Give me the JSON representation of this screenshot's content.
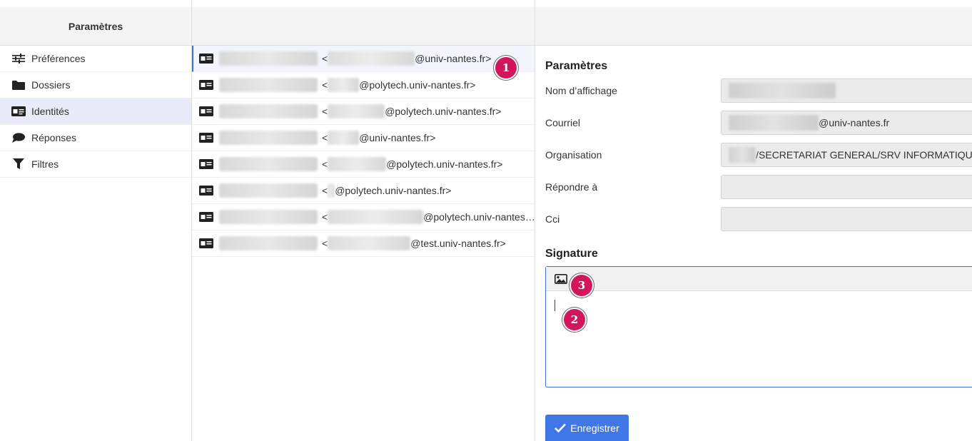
{
  "settings_panel": {
    "title": "Paramètres",
    "items": [
      {
        "label": "Préférences",
        "icon": "sliders-icon"
      },
      {
        "label": "Dossiers",
        "icon": "folder-icon"
      },
      {
        "label": "Identités",
        "icon": "id-card-icon",
        "selected": true
      },
      {
        "label": "Réponses",
        "icon": "comment-icon"
      },
      {
        "label": "Filtres",
        "icon": "filter-icon"
      }
    ]
  },
  "identities": [
    {
      "prefix": "<",
      "domain": "@univ-nantes.fr>",
      "selected": true
    },
    {
      "prefix": "<",
      "domain": "@polytech.univ-nantes.fr>"
    },
    {
      "prefix": "<",
      "domain": "@polytech.univ-nantes.fr>"
    },
    {
      "prefix": "<",
      "domain": "@univ-nantes.fr>"
    },
    {
      "prefix": "<",
      "domain": "@polytech.univ-nantes.fr>"
    },
    {
      "prefix": "<",
      "domain": "@polytech.univ-nantes.fr>"
    },
    {
      "prefix": "<",
      "domain": "@polytech.univ-nantes…"
    },
    {
      "prefix": "<",
      "domain": "@test.univ-nantes.fr>"
    }
  ],
  "form": {
    "section_title": "Paramètres",
    "fields": {
      "display_name": {
        "label": "Nom d’affichage",
        "value": ""
      },
      "email": {
        "label": "Courriel",
        "value": "@univ-nantes.fr"
      },
      "organization": {
        "label": "Organisation",
        "value": "/SECRETARIAT GENERAL/SRV INFORMATIQUE"
      },
      "reply_to": {
        "label": "Répondre à",
        "value": ""
      },
      "bcc": {
        "label": "Cci",
        "value": ""
      }
    },
    "signature_title": "Signature",
    "signature_value": ""
  },
  "save_button": {
    "label": "Enregistrer"
  },
  "badges": [
    "1",
    "2",
    "3"
  ],
  "colors": {
    "accent": "#3f77e5",
    "badge": "#d3155c",
    "selected_nav": "#e9ecf8"
  }
}
